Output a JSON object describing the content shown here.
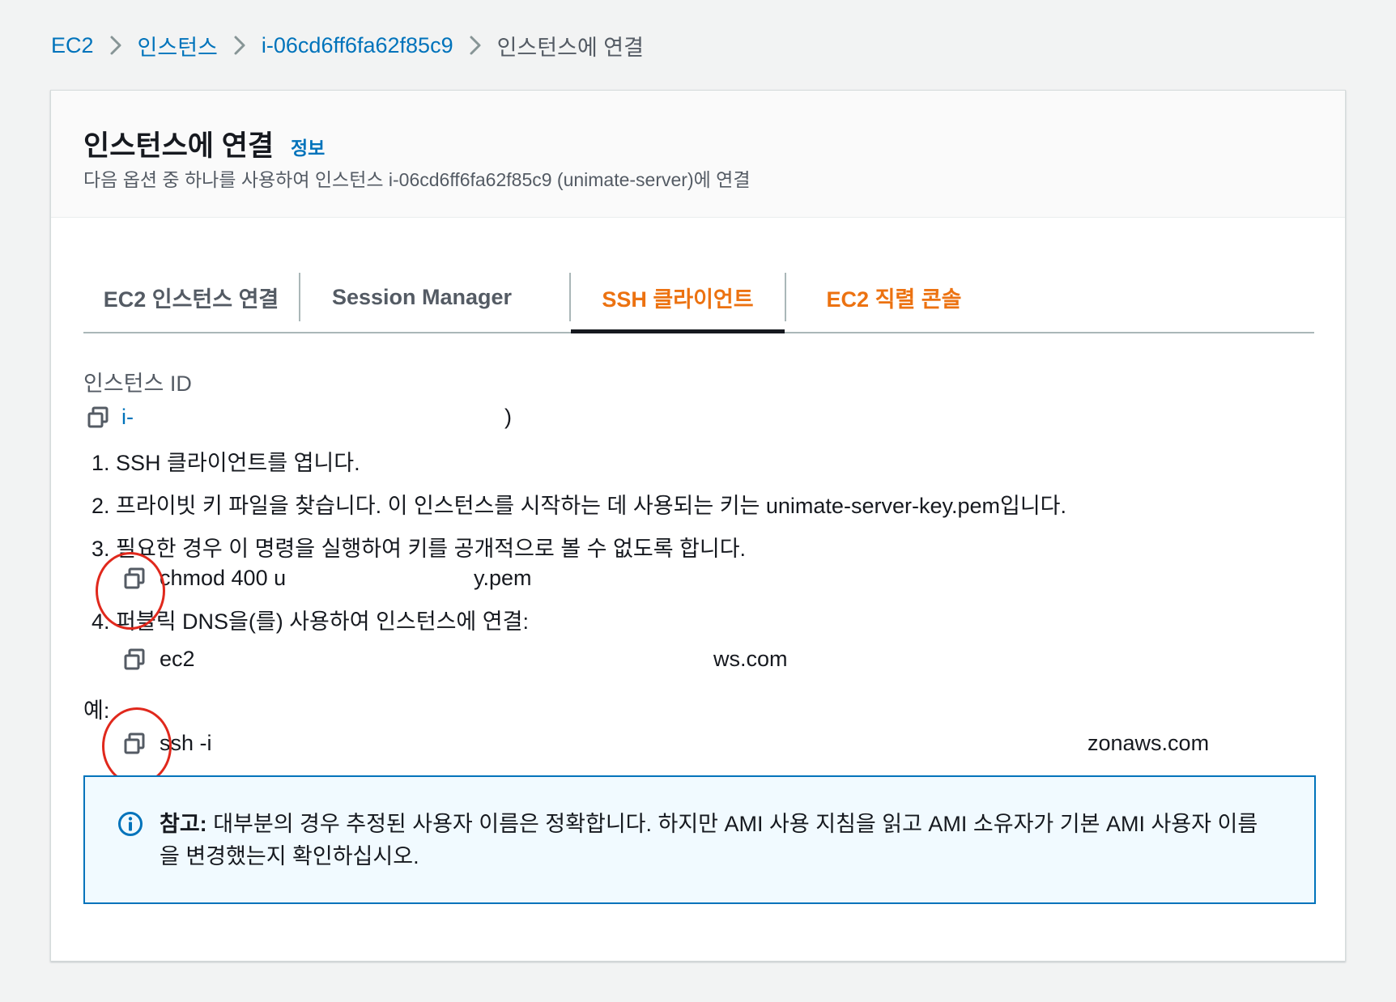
{
  "breadcrumb": {
    "items": [
      "EC2",
      "인스턴스",
      "i-06cd6ff6fa62f85c9"
    ],
    "current": "인스턴스에 연결"
  },
  "header": {
    "title": "인스턴스에 연결",
    "info_link": "정보",
    "description": "다음 옵션 중 하나를 사용하여 인스턴스 i-06cd6ff6fa62f85c9 (unimate-server)에 연결"
  },
  "tabs": [
    {
      "label": "EC2 인스턴스 연결",
      "active": false
    },
    {
      "label": "Session Manager",
      "active": false
    },
    {
      "label": "SSH 클라이언트",
      "active": true
    },
    {
      "label": "EC2 직렬 콘솔",
      "active": false
    }
  ],
  "instance_id": {
    "label": "인스턴스 ID",
    "value": "i-",
    "tail": ")"
  },
  "steps": [
    "1. SSH 클라이언트를 엽니다.",
    "2. 프라이빗 키 파일을 찾습니다. 이 인스턴스를 시작하는 데 사용되는 키는 unimate-server-key.pem입니다.",
    "3. 필요한 경우 이 명령을 실행하여 키를 공개적으로 볼 수 없도록 합니다.",
    "4. 퍼블릭 DNS을(를) 사용하여 인스턴스에 연결:"
  ],
  "commands": {
    "chmod_start": "chmod 400 u",
    "chmod_end": "y.pem",
    "dns_start": "ec2",
    "dns_end": "ws.com",
    "ssh_start": "ssh -i",
    "ssh_end": "zonaws.com"
  },
  "example_label": "예:",
  "alert": {
    "title": "참고:",
    "text": "대부분의 경우 추정된 사용자 이름은 정확합니다. 하지만 AMI 사용 지침을 읽고 AMI 소유자가 기본 AMI 사용자 이름을 변경했는지 확인하십시오."
  },
  "colors": {
    "link": "#0073bb",
    "tab_orange": "#ec7211",
    "annotation_red": "#e0281c",
    "alert_border": "#0073bb"
  },
  "icons": {
    "copy": "copy-icon",
    "separator": "chevron-right-icon",
    "alert": "info-circle-icon"
  }
}
